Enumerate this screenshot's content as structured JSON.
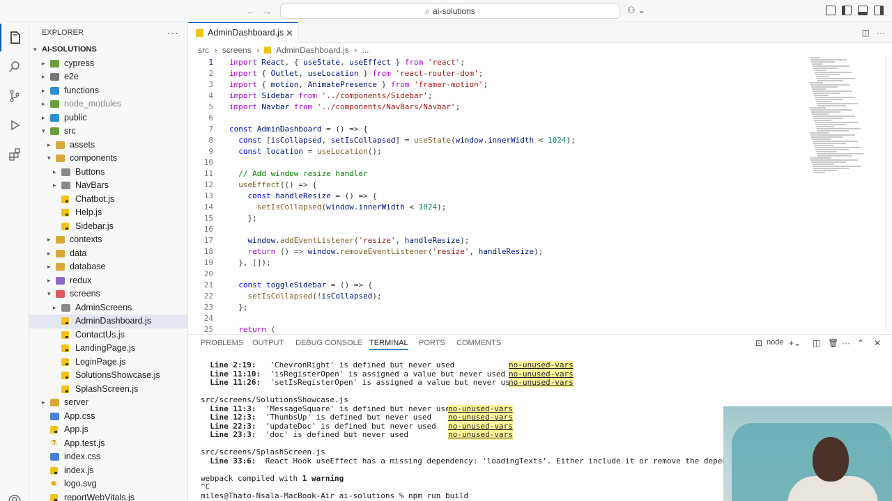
{
  "titlebar": {
    "search_text": "ai-solutions",
    "back_icon": "arrow-left-icon",
    "forward_icon": "arrow-right-icon"
  },
  "sidebar": {
    "title": "EXPLORER",
    "more": "···",
    "root": "AI-SOLUTIONS",
    "items": [
      {
        "label": "cypress",
        "depth": 1,
        "type": "folder",
        "open": false
      },
      {
        "label": "e2e",
        "depth": 1,
        "type": "folder",
        "open": false
      },
      {
        "label": "functions",
        "depth": 1,
        "type": "folder",
        "open": false
      },
      {
        "label": "node_modules",
        "depth": 1,
        "type": "folder",
        "open": false,
        "dim": true
      },
      {
        "label": "public",
        "depth": 1,
        "type": "folder",
        "open": false
      },
      {
        "label": "src",
        "depth": 1,
        "type": "folder",
        "open": true
      },
      {
        "label": "assets",
        "depth": 2,
        "type": "folder",
        "open": false
      },
      {
        "label": "components",
        "depth": 2,
        "type": "folder",
        "open": true
      },
      {
        "label": "Buttons",
        "depth": 3,
        "type": "folder",
        "open": false
      },
      {
        "label": "NavBars",
        "depth": 3,
        "type": "folder",
        "open": false
      },
      {
        "label": "Chatbot.js",
        "depth": 3,
        "type": "js"
      },
      {
        "label": "Help.js",
        "depth": 3,
        "type": "js"
      },
      {
        "label": "Sidebar.js",
        "depth": 3,
        "type": "js"
      },
      {
        "label": "contexts",
        "depth": 2,
        "type": "folder",
        "open": false
      },
      {
        "label": "data",
        "depth": 2,
        "type": "folder",
        "open": false
      },
      {
        "label": "database",
        "depth": 2,
        "type": "folder",
        "open": false
      },
      {
        "label": "redux",
        "depth": 2,
        "type": "folder",
        "open": false
      },
      {
        "label": "screens",
        "depth": 2,
        "type": "folder",
        "open": true
      },
      {
        "label": "AdminScreens",
        "depth": 3,
        "type": "folder",
        "open": false
      },
      {
        "label": "AdminDashboard.js",
        "depth": 3,
        "type": "js",
        "selected": true
      },
      {
        "label": "ContactUs.js",
        "depth": 3,
        "type": "js"
      },
      {
        "label": "LandingPage.js",
        "depth": 3,
        "type": "js"
      },
      {
        "label": "LoginPage.js",
        "depth": 3,
        "type": "js"
      },
      {
        "label": "SolutionsShowcase.js",
        "depth": 3,
        "type": "js"
      },
      {
        "label": "SplashScreen.js",
        "depth": 3,
        "type": "js"
      },
      {
        "label": "server",
        "depth": 1,
        "type": "folder",
        "open": false
      },
      {
        "label": "App.css",
        "depth": 1,
        "type": "css"
      },
      {
        "label": "App.js",
        "depth": 1,
        "type": "js"
      },
      {
        "label": "App.test.js",
        "depth": 1,
        "type": "test"
      },
      {
        "label": "index.css",
        "depth": 1,
        "type": "css"
      },
      {
        "label": "index.js",
        "depth": 1,
        "type": "js"
      },
      {
        "label": "logo.svg",
        "depth": 1,
        "type": "svg"
      },
      {
        "label": "reportWebVitals.js",
        "depth": 1,
        "type": "js"
      }
    ]
  },
  "editor": {
    "tab_label": "AdminDashboard.js",
    "close": "✕",
    "breadcrumb": [
      "src",
      "›",
      "screens",
      "›",
      "AdminDashboard.js",
      "›",
      "..."
    ],
    "lines": [
      "import React, { useState, useEffect } from 'react';",
      "import { Outlet, useLocation } from 'react-router-dom';",
      "import { motion, AnimatePresence } from 'framer-motion';",
      "import Sidebar from '../components/Sidebar';",
      "import Navbar from '../components/NavBars/Navbar';",
      "",
      "const AdminDashboard = () => {",
      "  const [isCollapsed, setIsCollapsed] = useState(window.innerWidth < 1024);",
      "  const location = useLocation();",
      "",
      "  // Add window resize handler",
      "  useEffect(() => {",
      "    const handleResize = () => {",
      "      setIsCollapsed(window.innerWidth < 1024);",
      "    };",
      "",
      "    window.addEventListener('resize', handleResize);",
      "    return () => window.removeEventListener('resize', handleResize);",
      "  }, []);",
      "",
      "  const toggleSidebar = () => {",
      "    setIsCollapsed(!isCollapsed);",
      "  };",
      "",
      "  return ("
    ]
  },
  "panel": {
    "tabs": [
      "PROBLEMS",
      "OUTPUT",
      "DEBUG CONSOLE",
      "TERMINAL",
      "PORTS",
      "COMMENTS"
    ],
    "active_tab": "TERMINAL",
    "terminal_name": "node",
    "terminal_lines": [
      {
        "text": "  Line 2:19:   'ChevronRight' is defined but never used",
        "rule": "no-unused-vars",
        "rule_col": 442
      },
      {
        "text": "  Line 11:10:  'isRegisterOpen' is assigned a value but never used",
        "rule": "no-unused-vars",
        "rule_col": 442
      },
      {
        "text": "  Line 11:26:  'setIsRegisterOpen' is assigned a value but never used",
        "rule": "no-unused-vars",
        "rule_col": 442
      },
      {
        "text": "",
        "rule": ""
      },
      {
        "text": "src/screens/SolutionsShowcase.js",
        "rule": ""
      },
      {
        "text": "  Line 11:3:  'MessageSquare' is defined but never used",
        "rule": "no-unused-vars",
        "rule_col": 355
      },
      {
        "text": "  Line 12:3:  'ThumbsUp' is defined but never used",
        "rule": "no-unused-vars",
        "rule_col": 355
      },
      {
        "text": "  Line 22:3:  'updateDoc' is defined but never used",
        "rule": "no-unused-vars",
        "rule_col": 355
      },
      {
        "text": "  Line 23:3:  'doc' is defined but never used",
        "rule": "no-unused-vars",
        "rule_col": 355
      },
      {
        "text": "",
        "rule": ""
      },
      {
        "text": "src/screens/SplashScreen.js",
        "rule": ""
      },
      {
        "text": "  Line 33:6:  React Hook useEffect has a missing dependency: 'loadingTexts'. Either include it or remove the dependency a",
        "rule": ""
      },
      {
        "text": "",
        "rule": ""
      },
      {
        "text": "webpack compiled with 1 warning",
        "rule": ""
      },
      {
        "text": "^C",
        "rule": ""
      },
      {
        "text": "miles@Thato-Nsala-MacBook-Air ai-solutions % npm run build",
        "rule": ""
      }
    ]
  },
  "colors": {
    "accent": "#005fb8",
    "keyword": "#af00db",
    "storage": "#0000ff",
    "string": "#a31515",
    "comment": "#008000",
    "variable": "#001080",
    "function": "#795e26",
    "number": "#098658"
  }
}
